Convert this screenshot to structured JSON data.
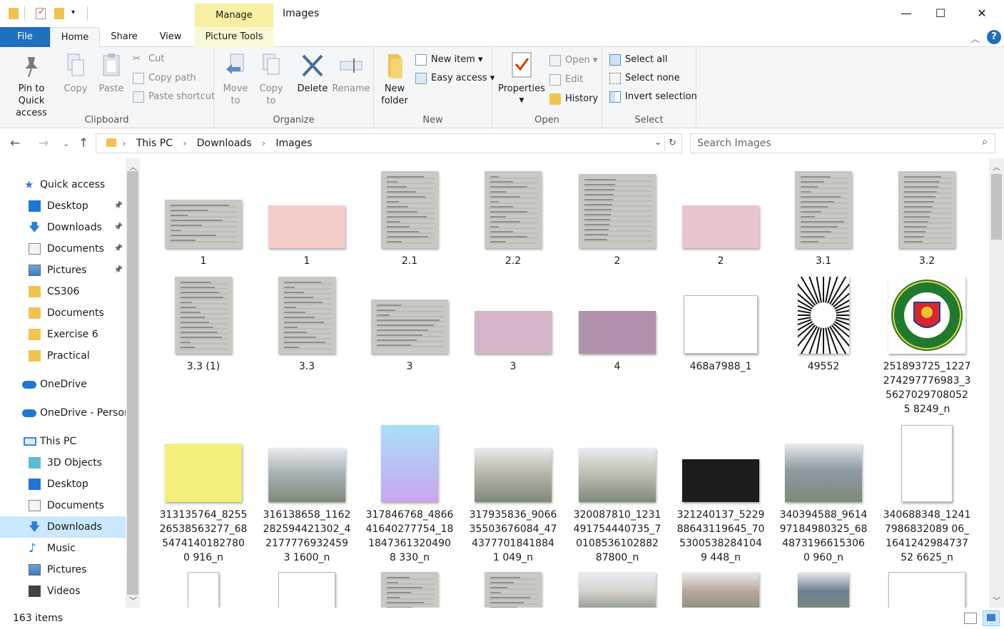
{
  "window": {
    "title": "Images",
    "manage_tab": "Manage",
    "minimize": "—",
    "maximize": "☐",
    "close": "✕"
  },
  "ribbon_tabs": {
    "file": "File",
    "home": "Home",
    "share": "Share",
    "view": "View",
    "picture_tools": "Picture Tools",
    "help": "?"
  },
  "ribbon": {
    "clipboard": {
      "label": "Clipboard",
      "pin": "Pin to Quick access",
      "copy": "Copy",
      "paste": "Paste",
      "cut": "Cut",
      "copy_path": "Copy path",
      "paste_shortcut": "Paste shortcut"
    },
    "organize": {
      "label": "Organize",
      "move_to": "Move to",
      "copy_to": "Copy to",
      "delete": "Delete",
      "rename": "Rename"
    },
    "new": {
      "label": "New",
      "new_folder": "New folder",
      "new_item": "New item",
      "easy_access": "Easy access"
    },
    "open": {
      "label": "Open",
      "properties": "Properties",
      "open": "Open",
      "edit": "Edit",
      "history": "History"
    },
    "select": {
      "label": "Select",
      "select_all": "Select all",
      "select_none": "Select none",
      "invert": "Invert selection"
    }
  },
  "address": {
    "crumbs": [
      "This PC",
      "Downloads",
      "Images"
    ],
    "search_placeholder": "Search Images"
  },
  "nav": {
    "quick_access": "Quick access",
    "items": [
      {
        "label": "Desktop",
        "icon": "desktop-icon",
        "pinned": true
      },
      {
        "label": "Downloads",
        "icon": "download-icon",
        "pinned": true
      },
      {
        "label": "Documents",
        "icon": "documents-icon",
        "pinned": true
      },
      {
        "label": "Pictures",
        "icon": "pictures-icon",
        "pinned": true
      },
      {
        "label": "CS306",
        "icon": "folder-icon",
        "pinned": false
      },
      {
        "label": "Documents",
        "icon": "folder-icon",
        "pinned": false
      },
      {
        "label": "Exercise 6",
        "icon": "folder-icon",
        "pinned": false
      },
      {
        "label": "Practical",
        "icon": "folder-icon",
        "pinned": false
      }
    ],
    "onedrive": "OneDrive",
    "onedrive_personal": "OneDrive - Person",
    "this_pc": "This PC",
    "pc_items": [
      {
        "label": "3D Objects",
        "icon": "3d-objects-icon"
      },
      {
        "label": "Desktop",
        "icon": "desktop-icon"
      },
      {
        "label": "Documents",
        "icon": "documents-icon"
      },
      {
        "label": "Downloads",
        "icon": "download-icon",
        "selected": true
      },
      {
        "label": "Music",
        "icon": "music-icon"
      },
      {
        "label": "Pictures",
        "icon": "pictures-icon"
      },
      {
        "label": "Videos",
        "icon": "videos-icon"
      }
    ]
  },
  "files": {
    "row1": [
      "1",
      "1",
      "2.1",
      "2.2",
      "2",
      "2",
      "3.1",
      "3.2"
    ],
    "row2": [
      "3.3 (1)",
      "3.3",
      "3",
      "3",
      "4",
      "468a7988_1",
      "49552",
      "251893725_1227274297776983_356270297080525 8249_n"
    ],
    "row3": [
      "313135764_825526538563277_6854741401827800 916_n",
      "316138658_1162282594421302_421777769324593 1600_n",
      "317846768_486641640277754_1818473613204908 330_n",
      "317935836_906635503676084_4743777018418841 049_n",
      "320087810_1231491754440735_7010853610288287800_n",
      "321240137_522988643119645_7053005382841049 448_n",
      "340394588_961497184980325_6848731966153060 960_n",
      "340688348_12417986832089 06_164124298473752 6625_n"
    ]
  },
  "status": {
    "count": "163 items"
  }
}
